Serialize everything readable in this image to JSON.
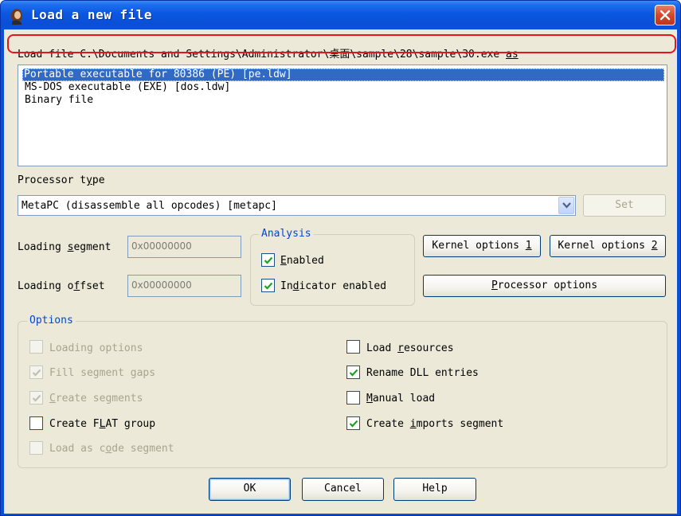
{
  "window": {
    "title": "Load a new file",
    "icon": "ida-icon",
    "close_icon": "close-icon"
  },
  "load_file_label_prefix": "Load file C:\\Documents and Settings\\Administrator\\桌面\\sample\\28\\sample\\30.exe ",
  "load_file_label_as": "as",
  "file_types": [
    {
      "label": "Portable executable for 80386 (PE) [pe.ldw]",
      "selected": true
    },
    {
      "label": "MS-DOS executable (EXE) [dos.ldw]",
      "selected": false
    },
    {
      "label": "Binary file",
      "selected": false
    }
  ],
  "processor": {
    "label_a": "Processor t",
    "label_u": "y",
    "label_b": "pe",
    "value": "MetaPC (disassemble all opcodes) [metapc]",
    "set_button": "Set"
  },
  "segment": {
    "label_a": "Loading ",
    "label_u": "s",
    "label_b": "egment",
    "value": "0x00000000"
  },
  "offset": {
    "label_a": "Loading o",
    "label_u": "f",
    "label_b": "fset",
    "value": "0x00000000"
  },
  "analysis": {
    "legend": "Analysis",
    "enabled": {
      "label_u": "E",
      "label_b": "nabled",
      "checked": true
    },
    "indicator": {
      "label_a": "In",
      "label_u": "d",
      "label_b": "icator enabled",
      "checked": true
    }
  },
  "buttons": {
    "kernel1_a": "Kernel options ",
    "kernel1_u": "1",
    "kernel2_a": "Kernel options ",
    "kernel2_u": "2",
    "processor_options_u": "P",
    "processor_options_b": "rocessor options",
    "ok": "OK",
    "cancel": "Cancel",
    "help": "Help"
  },
  "options": {
    "legend": "Options",
    "loading_options": {
      "label": "Loading options",
      "checked": false,
      "disabled": true
    },
    "fill_segment_gaps": {
      "label": "Fill segment gaps",
      "checked": true,
      "disabled": true
    },
    "create_segments": {
      "label_u": "C",
      "label_b": "reate segments",
      "checked": true,
      "disabled": true
    },
    "create_flat_group": {
      "label_a": "Create F",
      "label_u": "L",
      "label_b": "AT group",
      "checked": false,
      "disabled": false
    },
    "load_as_code_segment": {
      "label_a": "Load as c",
      "label_u": "o",
      "label_b": "de segment",
      "checked": false,
      "disabled": true
    },
    "load_resources": {
      "label_a": "Load ",
      "label_u": "r",
      "label_b": "esources",
      "checked": false,
      "disabled": false
    },
    "rename_dll_entries": {
      "label": "Rename DLL entries",
      "checked": true,
      "disabled": false
    },
    "manual_load": {
      "label_u": "M",
      "label_b": "anual load",
      "checked": false,
      "disabled": false
    },
    "create_imports_segment": {
      "label_a": "Create ",
      "label_u": "i",
      "label_b": "mports segment",
      "checked": true,
      "disabled": false
    }
  }
}
